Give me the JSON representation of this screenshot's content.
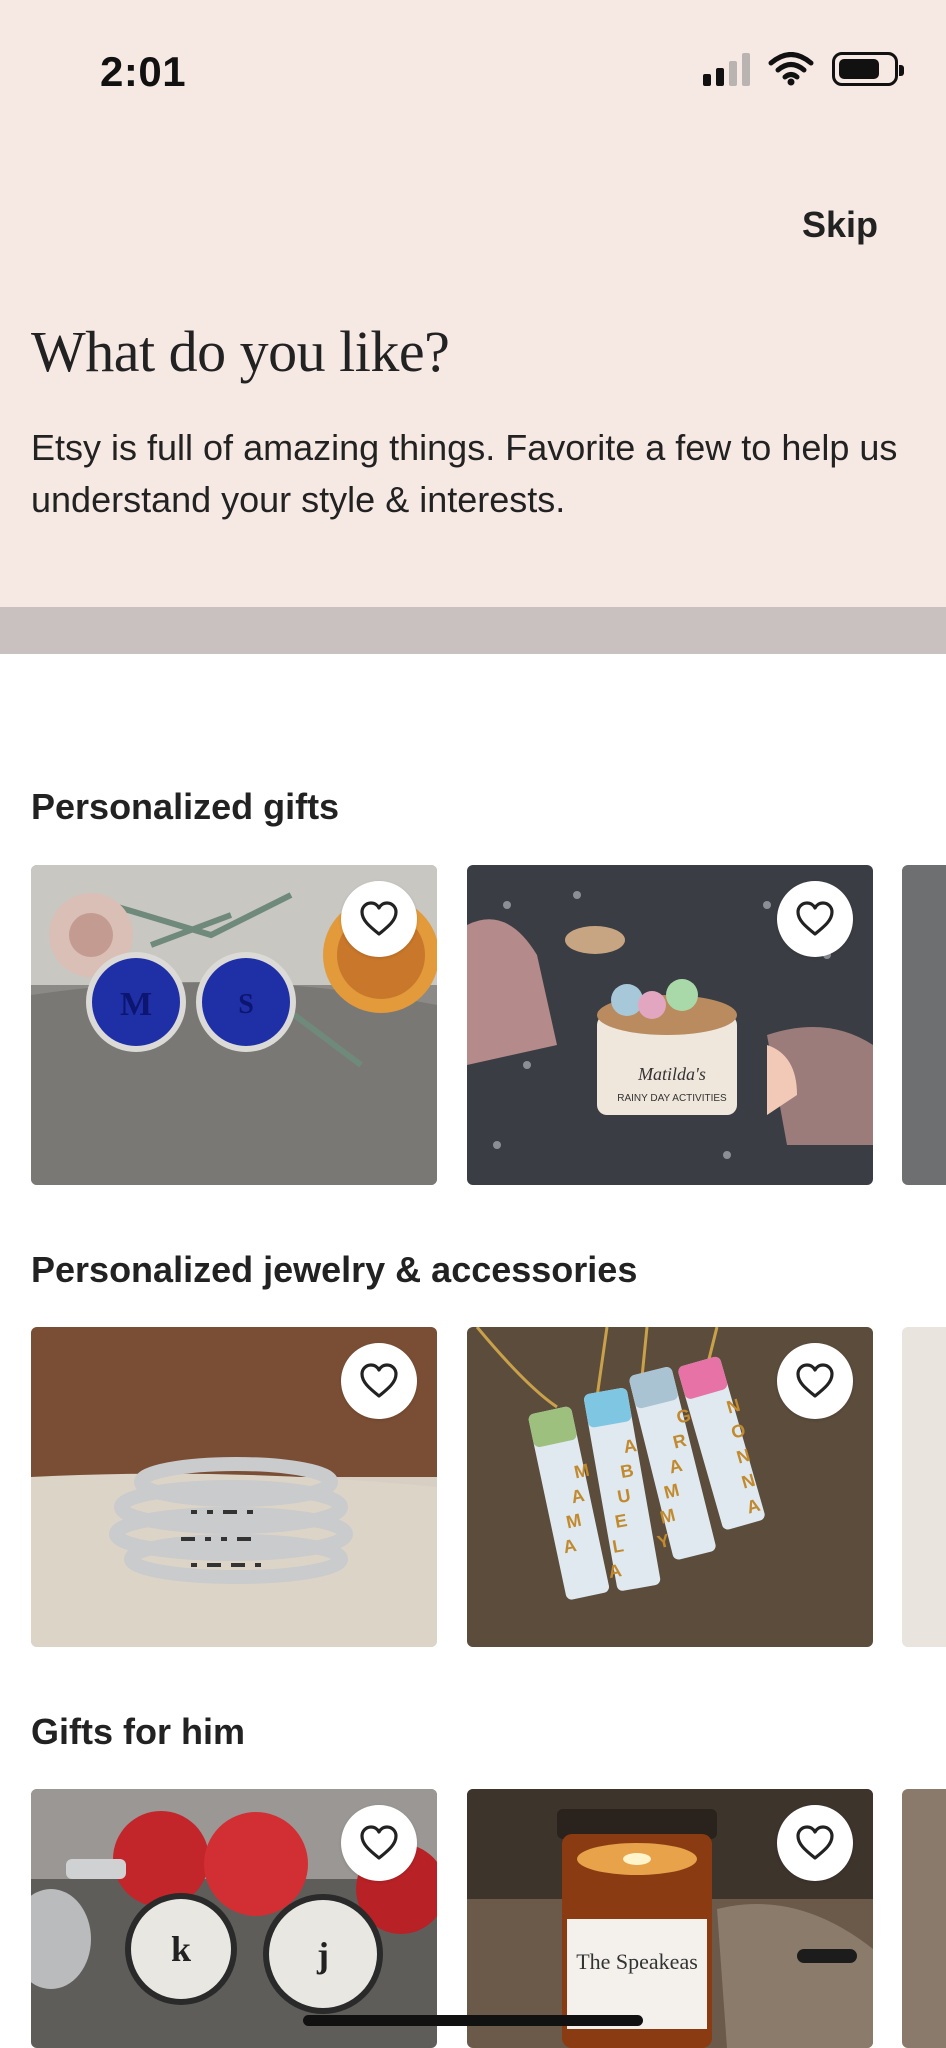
{
  "status_bar": {
    "time": "2:01",
    "signal_icon": "cellular-signal-icon",
    "wifi_icon": "wifi-icon",
    "battery_icon": "battery-icon"
  },
  "header": {
    "skip_label": "Skip",
    "title": "What do you like?",
    "subtitle": "Etsy is full of amazing things. Favorite a few to help us understand your style & interests."
  },
  "colors": {
    "header_bg": "#f6e9e4",
    "band": "#c8c1bf",
    "text": "#222222"
  },
  "sections": [
    {
      "title": "Personalized gifts",
      "items": [
        {
          "favorite_icon": "heart-outline-icon"
        },
        {
          "favorite_icon": "heart-outline-icon"
        }
      ]
    },
    {
      "title": "Personalized jewelry & accessories",
      "items": [
        {
          "favorite_icon": "heart-outline-icon"
        },
        {
          "favorite_icon": "heart-outline-icon",
          "image_text": [
            "MAMA",
            "ABUELA",
            "GRAMMY",
            "NONNA"
          ]
        }
      ]
    },
    {
      "title": "Gifts for him",
      "items": [
        {
          "favorite_icon": "heart-outline-icon",
          "image_text": [
            "k",
            "j"
          ]
        },
        {
          "favorite_icon": "heart-outline-icon",
          "image_text": [
            "The Speakeas"
          ]
        }
      ]
    }
  ],
  "card_images": {
    "cufflinks_letters": [
      "M",
      "S"
    ],
    "jar_label": [
      "Matilda's",
      "RAINY DAY ACTIVITIES"
    ]
  }
}
